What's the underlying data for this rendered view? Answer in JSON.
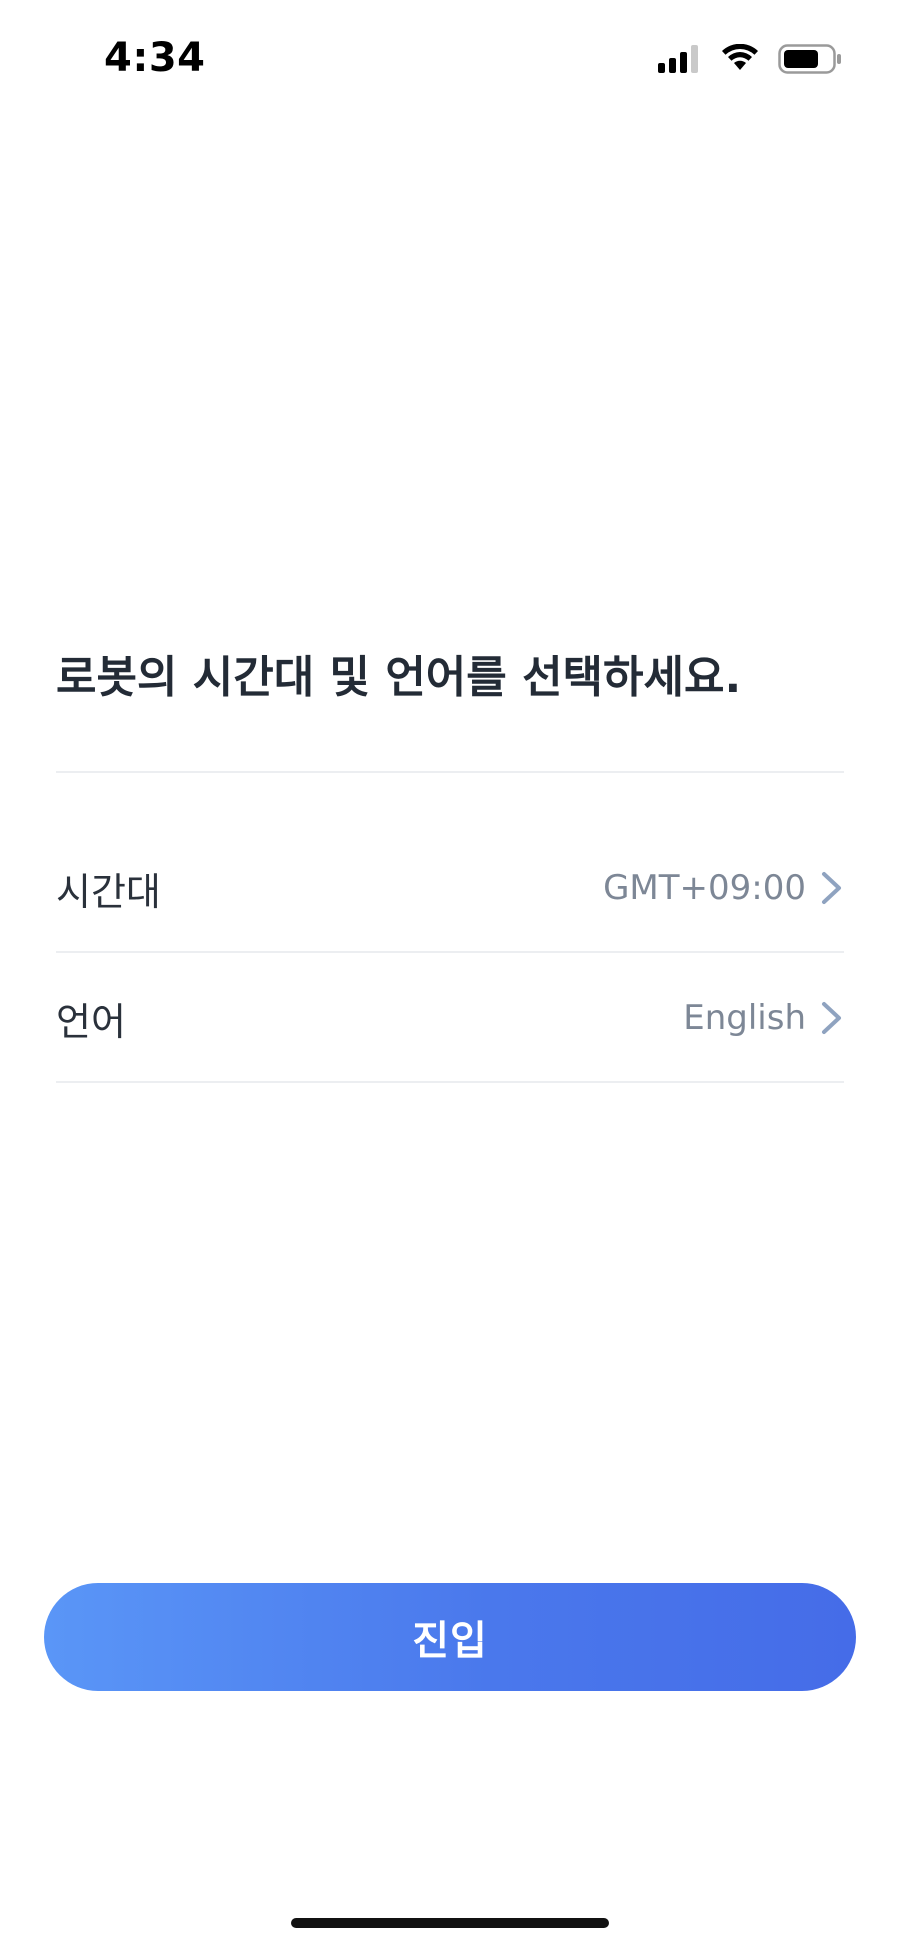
{
  "status_bar": {
    "time": "4:34",
    "icons": [
      "cellular-signal-icon",
      "wifi-icon",
      "battery-icon"
    ]
  },
  "main": {
    "title": "로봇의 시간대 및 언어를 선택하세요.",
    "rows": [
      {
        "label": "시간대",
        "value": "GMT+09:00",
        "icon": "chevron-right-icon"
      },
      {
        "label": "언어",
        "value": "English",
        "icon": "chevron-right-icon"
      }
    ]
  },
  "actions": {
    "enter_label": "진입"
  },
  "colors": {
    "accent_start": "#5a96f7",
    "accent_end": "#456ce8",
    "value_text": "#7d8796",
    "chevron": "#8fa3c0"
  }
}
